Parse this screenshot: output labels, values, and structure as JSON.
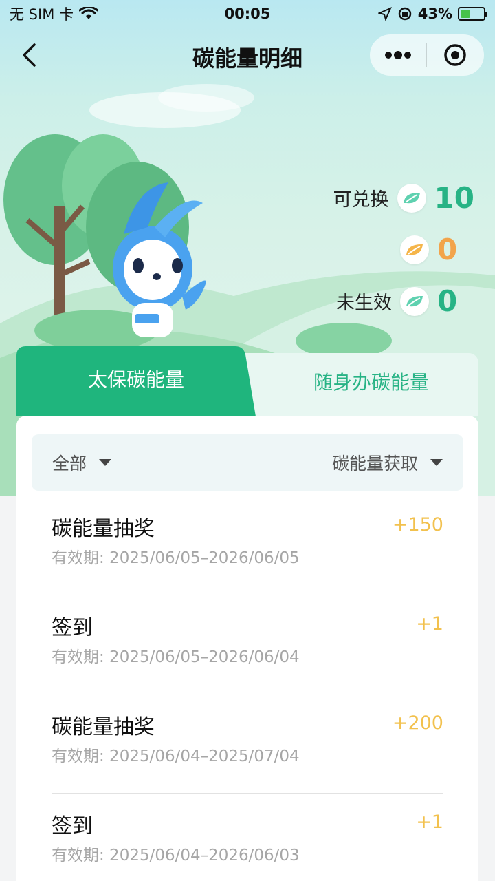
{
  "status_bar": {
    "carrier": "无 SIM 卡",
    "time": "00:05",
    "battery": "43%"
  },
  "nav": {
    "title": "碳能量明细",
    "more_icon": "more-dots-icon",
    "close_icon": "target-close-icon"
  },
  "stats": [
    {
      "label": "可兑换",
      "value": "10",
      "color": "#27b385"
    },
    {
      "label": "",
      "value": "0",
      "color": "#f2a44b"
    },
    {
      "label": "未生效",
      "value": "0",
      "color": "#27b385"
    }
  ],
  "tabs": {
    "active": "太保碳能量",
    "inactive": "随身办碳能量"
  },
  "filter": {
    "left": "全部",
    "right": "碳能量获取"
  },
  "records": [
    {
      "title": "碳能量抽奖",
      "date": "有效期: 2025/06/05–2026/06/05",
      "points": "+150"
    },
    {
      "title": "签到",
      "date": "有效期: 2025/06/05–2026/06/04",
      "points": "+1"
    },
    {
      "title": "碳能量抽奖",
      "date": "有效期: 2025/06/04–2025/07/04",
      "points": "+200"
    },
    {
      "title": "签到",
      "date": "有效期: 2025/06/04–2026/06/03",
      "points": "+1"
    }
  ],
  "colors": {
    "accent": "#1fb57d",
    "points": "#f2c14e"
  }
}
